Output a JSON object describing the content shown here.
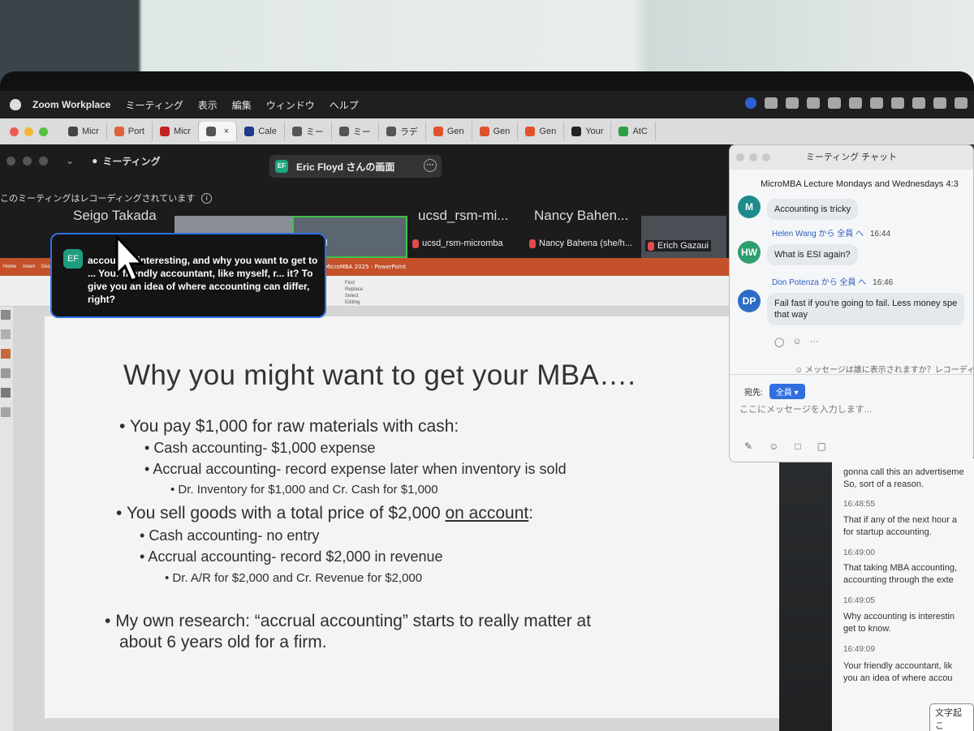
{
  "menubar": {
    "app": "Zoom Workplace",
    "items": [
      "ミーティング",
      "表示",
      "編集",
      "ウィンドウ",
      "ヘルプ"
    ]
  },
  "browser_tabs": [
    {
      "label": "Micr",
      "color": "#444444"
    },
    {
      "label": "Port",
      "color": "#e0623a"
    },
    {
      "label": "Micr",
      "color": "#c5221f"
    },
    {
      "label": "",
      "color": "#555555",
      "active": true
    },
    {
      "label": "Cale",
      "color": "#1f3a8a"
    },
    {
      "label": "ミー",
      "color": "#555555"
    },
    {
      "label": "ミー",
      "color": "#555555"
    },
    {
      "label": "ラデ",
      "color": "#555555"
    },
    {
      "label": "Gen",
      "color": "#e0532a"
    },
    {
      "label": "Gen",
      "color": "#e0532a"
    },
    {
      "label": "Gen",
      "color": "#e0532a"
    },
    {
      "label": "Your",
      "color": "#222222"
    },
    {
      "label": "AtC",
      "color": "#2e9e45"
    }
  ],
  "zoom": {
    "meeting_label": "ミーティング",
    "screen_share": "Eric Floyd さんの画面",
    "recording_notice": "このミーティングはレコーディングされています",
    "participants": [
      {
        "top_name": "Seigo Takada"
      },
      {
        "caption": "yd"
      },
      {
        "top_name": "ucsd_rsm-mi...",
        "caption": "ucsd_rsm-micromba"
      },
      {
        "top_name": "Nancy Bahen...",
        "caption": "Nancy Bahena (she/h..."
      },
      {
        "caption": "Erich Gazaui"
      }
    ]
  },
  "ppt": {
    "title": "MicroMBA 2025 - PowerPoint",
    "tabs": [
      "Home",
      "Insert",
      "Design"
    ],
    "editing_items": [
      "Find",
      "Replace",
      "Select",
      "Editing"
    ]
  },
  "caption": {
    "initials": "EF",
    "text": "accou... is interesting, and why you want to get to ... Your friendly accountant, like myself, r... it? To give you an idea of where accounting can differ, right?"
  },
  "slide": {
    "title": "Why you might want to get your MBA….",
    "bullets": [
      "You pay $1,000 for raw materials with cash:",
      "Cash accounting- $1,000 expense",
      "Accrual accounting- record expense later when inventory is sold",
      "Dr. Inventory for $1,000 and Cr. Cash for $1,000",
      "You sell goods with a total price of $2,000",
      "on account",
      ":",
      "Cash accounting- no entry",
      "Accrual accounting- record $2,000 in revenue",
      "Dr. A/R for $2,000 and Cr. Revenue for $2,000",
      "My own research: “accrual accounting” starts to really matter at",
      "about 6 years old for a firm."
    ]
  },
  "chat": {
    "header": "ミーティング チャット",
    "meeting_name": "MicroMBA Lecture Mondays and Wednesdays 4:3",
    "messages": [
      {
        "initial": "M",
        "color": "#1e8b8b",
        "sender": "",
        "to": "",
        "time": "",
        "lines": [
          "Accounting is tricky"
        ]
      },
      {
        "initial": "HW",
        "color": "#2f9e6e",
        "sender": "Helen Wang から 全員 へ",
        "to": "",
        "time": "16:44",
        "lines": [
          "What is ESI again?"
        ]
      },
      {
        "initial": "DP",
        "color": "#2c6cc4",
        "sender": "Don Potenza から 全員 へ",
        "to": "",
        "time": "16:46",
        "lines": [
          "Fail fast if you're going to fail. Less money spe",
          "that way"
        ]
      }
    ],
    "who_sees": "メッセージは誰に表示されますか？レコーディ",
    "to_label": "宛先:",
    "to_value": "全員",
    "input_placeholder": "ここにメッセージを入力します..."
  },
  "transcript": {
    "entries": [
      {
        "time": "",
        "lines": [
          "gonna call this an advertiseme",
          "So, sort of a reason."
        ]
      },
      {
        "time": "16:48:55",
        "lines": [
          "That if any of the next hour a",
          "for startup accounting."
        ]
      },
      {
        "time": "16:49:00",
        "lines": [
          "That taking MBA accounting,",
          "accounting through the exte"
        ]
      },
      {
        "time": "16:49:05",
        "lines": [
          "Why accounting is interestin",
          "get to know."
        ]
      },
      {
        "time": "16:49:09",
        "lines": [
          "Your friendly accountant, lik",
          "you an idea of where accou"
        ]
      }
    ],
    "button": "文字起こ"
  }
}
